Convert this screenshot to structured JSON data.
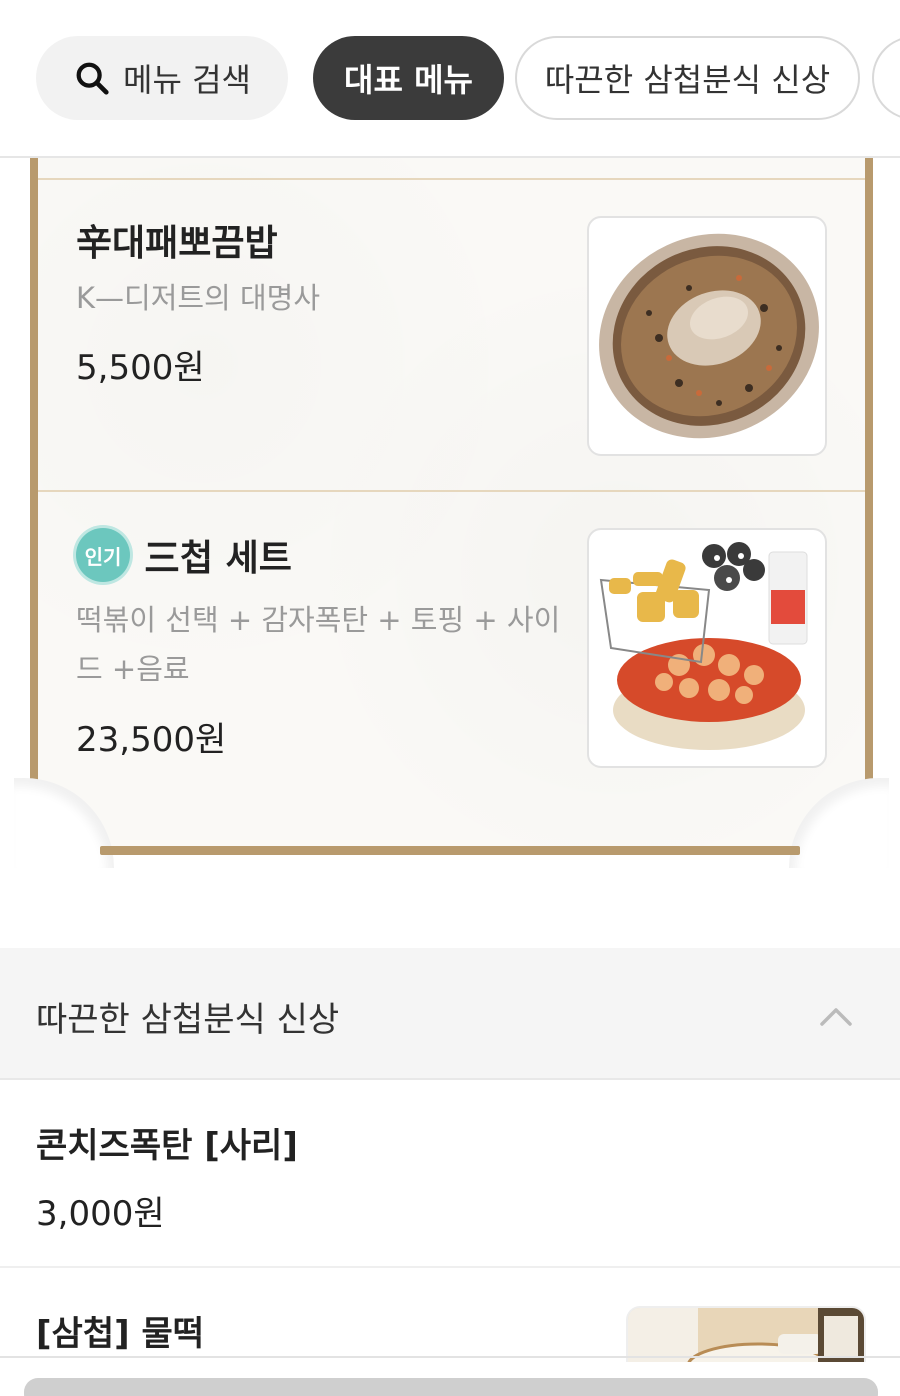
{
  "chips": {
    "search_label": "메뉴 검색",
    "active_label": "대표 메뉴",
    "outline_label": "따끈한 삼첩분식 신상"
  },
  "featured": {
    "items": [
      {
        "title": "辛대패뽀끔밥",
        "desc": "K—디저트의 대명사",
        "price": "5,500원",
        "image": "bokkeumbap-photo"
      },
      {
        "badge": "인기",
        "title": "三첩 세트",
        "desc_line1": "떡볶이 선택 + 감자폭탄 + 토핑 + 사이",
        "desc_line2": "드 +음료",
        "price": "23,500원",
        "image": "set-photo"
      }
    ]
  },
  "section": {
    "title": "따끈한 삼첩분식 신상",
    "icon": "chevron-up-icon"
  },
  "list": [
    {
      "title": "콘치즈폭탄 [사리]",
      "price": "3,000원"
    },
    {
      "title": "[삼첩] 물떡"
    }
  ],
  "colors": {
    "accent_dark": "#3b3b3b",
    "gold_border": "#b89a6d",
    "badge_teal": "#6cc7be"
  }
}
